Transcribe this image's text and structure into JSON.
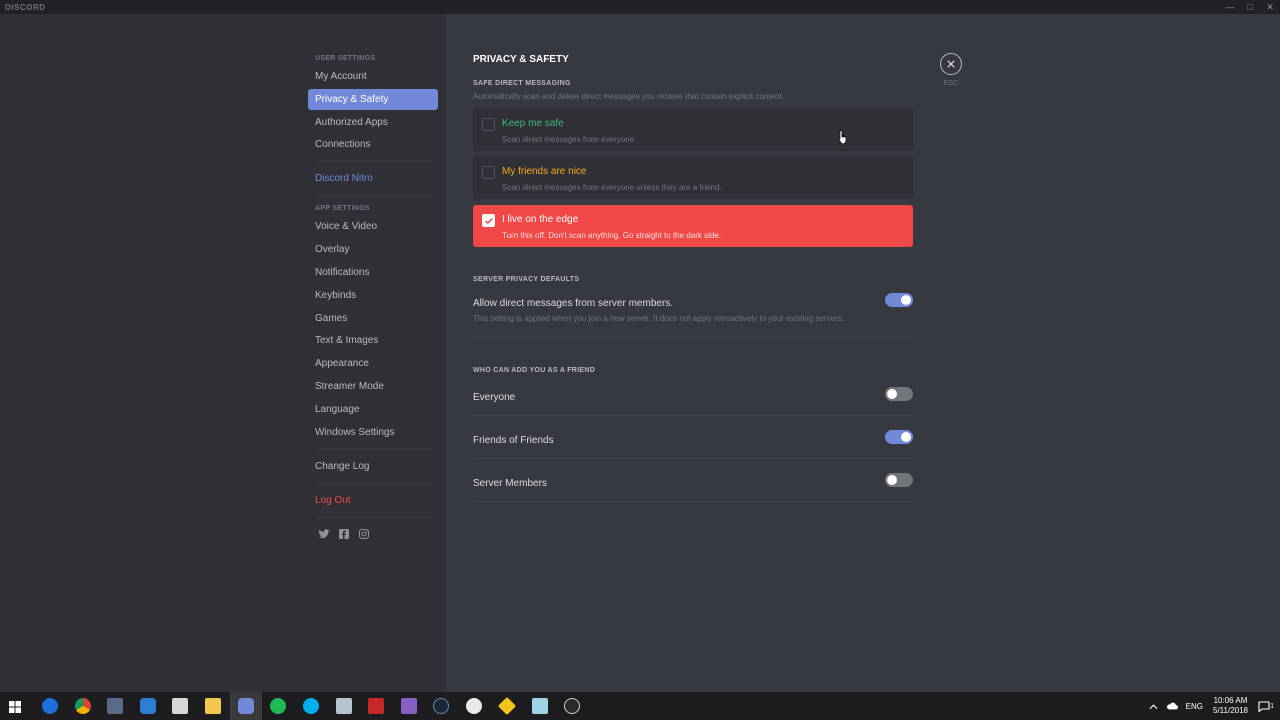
{
  "window": {
    "title": "DISCORD"
  },
  "sidebar": {
    "user_settings_header": "USER SETTINGS",
    "user_items": [
      "My Account",
      "Privacy & Safety",
      "Authorized Apps",
      "Connections"
    ],
    "nitro": "Discord Nitro",
    "app_settings_header": "APP SETTINGS",
    "app_items": [
      "Voice & Video",
      "Overlay",
      "Notifications",
      "Keybinds",
      "Games",
      "Text & Images",
      "Appearance",
      "Streamer Mode",
      "Language",
      "Windows Settings"
    ],
    "change_log": "Change Log",
    "log_out": "Log Out",
    "social_icons": [
      "twitter-icon",
      "facebook-icon",
      "instagram-icon"
    ]
  },
  "content": {
    "title": "PRIVACY & SAFETY",
    "safe_dm": {
      "title": "SAFE DIRECT MESSAGING",
      "description": "Automatically scan and delete direct messages you receive that contain explicit content.",
      "options": [
        {
          "label": "Keep me safe",
          "sub": "Scan direct messages from everyone.",
          "checked": false
        },
        {
          "label": "My friends are nice",
          "sub": "Scan direct messages from everyone unless they are a friend.",
          "checked": false
        },
        {
          "label": "I live on the edge",
          "sub": "Turn this off. Don't scan anything. Go straight to the dark side.",
          "checked": true
        }
      ]
    },
    "server_privacy": {
      "title": "SERVER PRIVACY DEFAULTS",
      "label": "Allow direct messages from server members.",
      "description": "This setting is applied when you join a new server. It does not apply retroactively to your existing servers.",
      "enabled": true
    },
    "friend_requests": {
      "title": "WHO CAN ADD YOU AS A FRIEND",
      "options": [
        {
          "label": "Everyone",
          "enabled": false
        },
        {
          "label": "Friends of Friends",
          "enabled": true
        },
        {
          "label": "Server Members",
          "enabled": false
        }
      ]
    },
    "close_label": "ESC"
  },
  "taskbar": {
    "language": "ENG",
    "time": "10:06 AM",
    "date": "5/11/2018",
    "notification_count": "1"
  },
  "colors": {
    "accent": "#7289da",
    "danger": "#f04747",
    "success": "#43b581",
    "warning": "#faa61a"
  }
}
